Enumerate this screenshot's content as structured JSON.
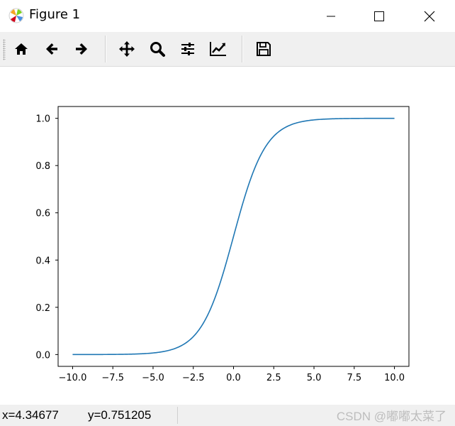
{
  "window": {
    "title": "Figure 1"
  },
  "toolbar": {
    "buttons": [
      {
        "name": "home"
      },
      {
        "name": "back"
      },
      {
        "name": "forward"
      },
      {
        "name": "pan"
      },
      {
        "name": "zoom"
      },
      {
        "name": "configure-subplots"
      },
      {
        "name": "edit-axis"
      },
      {
        "name": "save"
      }
    ]
  },
  "status": {
    "x_readout": "x=4.34677",
    "y_readout": "y=0.751205"
  },
  "watermark": "CSDN @嘟嘟太菜了",
  "colors": {
    "line": "#1f77b4",
    "toolbar_bg": "#f0f0f0"
  },
  "chart_data": {
    "type": "line",
    "function": "sigmoid",
    "x_range": [
      -10,
      10
    ],
    "xlim": [
      -10.9,
      10.9
    ],
    "ylim": [
      -0.05,
      1.05
    ],
    "x_ticks": [
      -10.0,
      -7.5,
      -5.0,
      -2.5,
      0.0,
      2.5,
      5.0,
      7.5,
      10.0
    ],
    "x_tick_labels": [
      "−10.0",
      "−7.5",
      "−5.0",
      "−2.5",
      "0.0",
      "2.5",
      "5.0",
      "7.5",
      "10.0"
    ],
    "y_ticks": [
      0.0,
      0.2,
      0.4,
      0.6,
      0.8,
      1.0
    ],
    "y_tick_labels": [
      "0.0",
      "0.2",
      "0.4",
      "0.6",
      "0.8",
      "1.0"
    ],
    "title": "",
    "xlabel": "",
    "ylabel": "",
    "grid": false,
    "legend": false
  }
}
